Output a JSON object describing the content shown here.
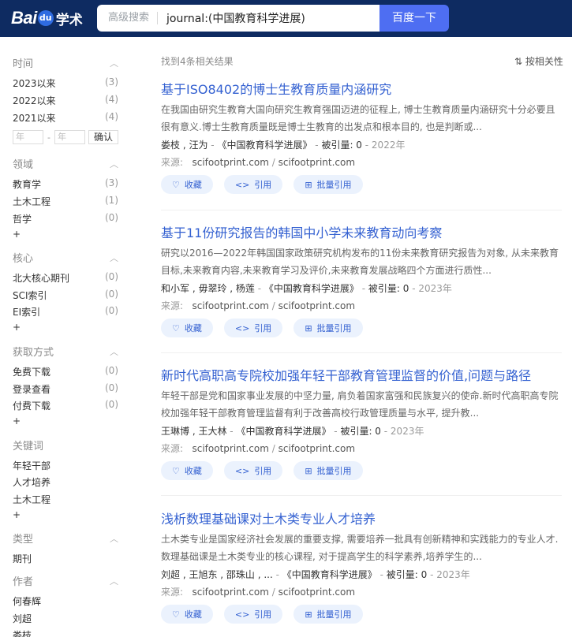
{
  "header": {
    "logo_bai": "Bai",
    "logo_du": "du",
    "logo_xueshu": "学术",
    "advanced_search": "高级搜索",
    "query": "journal:(中国教育科学进展)",
    "search_button": "百度一下"
  },
  "sidebar": {
    "time": {
      "label": "时间",
      "items": [
        {
          "label": "2023以来",
          "count": "(3)"
        },
        {
          "label": "2022以来",
          "count": "(4)"
        },
        {
          "label": "2021以来",
          "count": "(4)"
        }
      ],
      "from_placeholder": "年",
      "to_placeholder": "年",
      "dash": "-",
      "confirm": "确认"
    },
    "field": {
      "label": "领域",
      "items": [
        {
          "label": "教育学",
          "count": "(3)"
        },
        {
          "label": "土木工程",
          "count": "(1)"
        },
        {
          "label": "哲学",
          "count": "(0)"
        }
      ],
      "more": "+"
    },
    "core": {
      "label": "核心",
      "items": [
        {
          "label": "北大核心期刊",
          "count": "(0)"
        },
        {
          "label": "SCI索引",
          "count": "(0)"
        },
        {
          "label": "EI索引",
          "count": "(0)"
        }
      ],
      "more": "+"
    },
    "access": {
      "label": "获取方式",
      "items": [
        {
          "label": "免费下载",
          "count": "(0)"
        },
        {
          "label": "登录查看",
          "count": "(0)"
        },
        {
          "label": "付费下载",
          "count": "(0)"
        }
      ],
      "more": "+"
    },
    "keywords": {
      "label": "关键词",
      "items": [
        {
          "label": "年轻干部"
        },
        {
          "label": "人才培养"
        },
        {
          "label": "土木工程"
        }
      ],
      "more": "+"
    },
    "type": {
      "label": "类型",
      "items": [
        {
          "label": "期刊"
        }
      ]
    },
    "author": {
      "label": "作者",
      "items": [
        {
          "label": "何春辉"
        },
        {
          "label": "刘超"
        },
        {
          "label": "娄枝"
        }
      ]
    }
  },
  "results": {
    "count_text": "找到4条相关结果",
    "sort_label": "按相关性",
    "cards": [
      {
        "title": "基于ISO8402的博士生教育质量内涵研究",
        "abstract": "在我国由研究生教育大国向研究生教育强国迈进的征程上, 博士生教育质量内涵研究十分必要且很有意义.博士生教育质量既是博士生教育的出发点和根本目的, 也是判断或...",
        "authors": "娄枝 ,  汪为",
        "journal": "《中国教育科学进展》",
        "citations": "被引量: 0",
        "year": "2022年",
        "source_label": "来源:",
        "source_1": "scifootprint.com",
        "source_2": "scifootprint.com"
      },
      {
        "title": "基于11份研究报告的韩国中小学未来教育动向考察",
        "abstract": "研究以2016—2022年韩国国家政策研究机构发布的11份未来教育研究报告为对象, 从未来教育目标,未来教育内容,未来教育学习及评价,未来教育发展战略四个方面进行质性...",
        "authors": "和小军 ,  毋翠玲 ,  杨莲",
        "journal": "《中国教育科学进展》",
        "citations": "被引量: 0",
        "year": "2023年",
        "source_label": "来源:",
        "source_1": "scifootprint.com",
        "source_2": "scifootprint.com"
      },
      {
        "title": "新时代高职高专院校加强年轻干部教育管理监督的价值,问题与路径",
        "abstract": "年轻干部是党和国家事业发展的中坚力量, 肩负着国家富强和民族复兴的使命.新时代高职高专院校加强年轻干部教育管理监督有利于改善高校行政管理质量与水平, 提升教...",
        "authors": "王琳博 ,  王大林",
        "journal": "《中国教育科学进展》",
        "citations": "被引量: 0",
        "year": "2023年",
        "source_label": "来源:",
        "source_1": "scifootprint.com",
        "source_2": "scifootprint.com"
      },
      {
        "title": "浅析数理基础课对土木类专业人才培养",
        "abstract": "土木类专业是国家经济社会发展的重要支撑, 需要培养一批具有创新精神和实践能力的专业人才.数理基础课是土木类专业的核心课程, 对于提高学生的科学素养,培养学生的...",
        "authors": "刘超 ,  王旭东 ,  邵珠山 ,  ...",
        "journal": "《中国教育科学进展》",
        "citations": "被引量: 0",
        "year": "2023年",
        "source_label": "来源:",
        "source_1": "scifootprint.com",
        "source_2": "scifootprint.com"
      }
    ],
    "btn_collect": "收藏",
    "btn_cite": "引用",
    "btn_batch": "批量引用"
  },
  "colors": {
    "header_bg": "#0e2b61",
    "accent": "#4e6ef2",
    "title_link": "#3461d1",
    "pill_bg": "#ebf2fd"
  }
}
